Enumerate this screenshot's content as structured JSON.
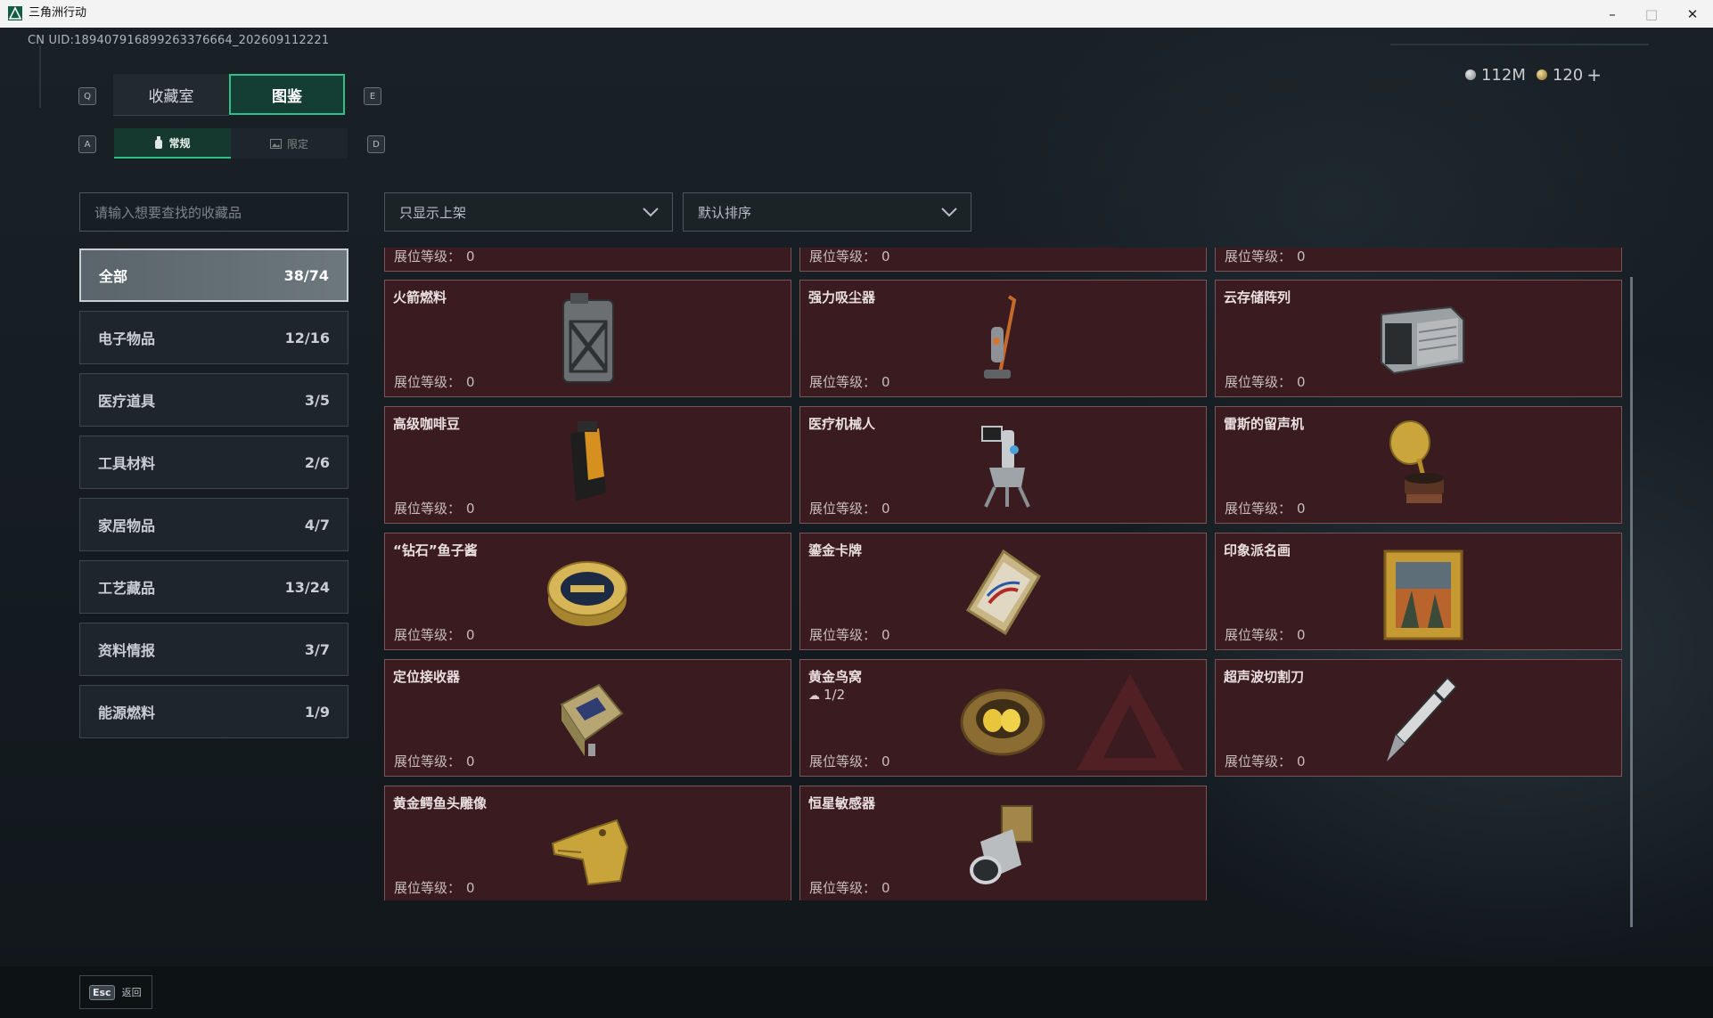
{
  "window": {
    "title": "三角洲行动",
    "minimize": "–",
    "maximize": "□",
    "close": "✕"
  },
  "uid": "CN UID:18940791689926337​6664_202609112221",
  "currency": {
    "silver": "112M",
    "gold": "120",
    "add": "+"
  },
  "keys": {
    "prev_tab": "Q",
    "next_tab": "E",
    "prev_sub": "A",
    "next_sub": "D"
  },
  "main_tabs": [
    {
      "label": "收藏室"
    },
    {
      "label": "图鉴"
    }
  ],
  "sub_tabs": [
    {
      "label": "常规"
    },
    {
      "label": "限定"
    }
  ],
  "search": {
    "placeholder": "请输入想要查找的收藏品"
  },
  "filters": {
    "display": "只显示上架",
    "sort": "默认排序"
  },
  "categories": [
    {
      "label": "全部",
      "count": "38/74"
    },
    {
      "label": "电子物品",
      "count": "12/16"
    },
    {
      "label": "医疗道具",
      "count": "3/5"
    },
    {
      "label": "工具材料",
      "count": "2/6"
    },
    {
      "label": "家居物品",
      "count": "4/7"
    },
    {
      "label": "工艺藏品",
      "count": "13/24"
    },
    {
      "label": "资料情报",
      "count": "3/7"
    },
    {
      "label": "能源燃料",
      "count": "1/9"
    }
  ],
  "level_label": "展位等级：",
  "items": [
    {
      "name": "",
      "level": "0",
      "icon": "partial-card"
    },
    {
      "name": "",
      "level": "0",
      "icon": "partial-card"
    },
    {
      "name": "",
      "level": "0",
      "icon": "partial-card"
    },
    {
      "name": "火箭燃料",
      "level": "0",
      "icon": "fuel-canister-icon"
    },
    {
      "name": "强力吸尘器",
      "level": "0",
      "icon": "vacuum-icon"
    },
    {
      "name": "云存储阵列",
      "level": "0",
      "icon": "server-icon"
    },
    {
      "name": "高级咖啡豆",
      "level": "0",
      "icon": "coffee-bag-icon"
    },
    {
      "name": "医疗机械人",
      "level": "0",
      "icon": "medical-robot-icon"
    },
    {
      "name": "雷斯的留声机",
      "level": "0",
      "icon": "gramophone-icon"
    },
    {
      "name": "“钻石”鱼子酱",
      "level": "0",
      "icon": "caviar-tin-icon"
    },
    {
      "name": "鎏金卡牌",
      "level": "0",
      "icon": "gilded-card-icon"
    },
    {
      "name": "印象派名画",
      "level": "0",
      "icon": "painting-icon"
    },
    {
      "name": "定位接收器",
      "level": "0",
      "icon": "gps-receiver-icon"
    },
    {
      "name": "黄金鸟窝",
      "level": "0",
      "icon": "golden-nest-icon",
      "sub": "1/2"
    },
    {
      "name": "超声波切割刀",
      "level": "0",
      "icon": "ultrasonic-knife-icon"
    },
    {
      "name": "黄金鳄鱼头雕像",
      "level": "0",
      "icon": "croc-statue-icon"
    },
    {
      "name": "恒星敏感器",
      "level": "0",
      "icon": "star-sensor-icon"
    }
  ],
  "back": {
    "key": "Esc",
    "label": "返回"
  },
  "colors": {
    "accent": "#2fbf88",
    "card_bg": "#3a1b1f",
    "card_border": "#7a5457"
  }
}
